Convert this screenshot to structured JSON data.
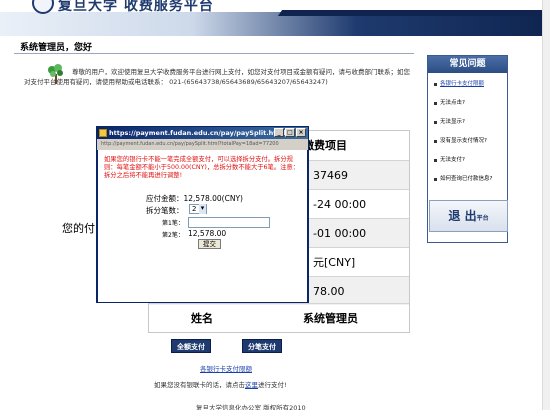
{
  "header": {
    "title": "复旦大学 收费服务平台"
  },
  "welcome": "系统管理员，您好",
  "notice": "尊敬的用户，欢迎使用复旦大学收费服务平台进行网上支付，如您对支付项目或金额有疑问，请与收费部门联系；如您对支付平台使用有疑问，请使用帮助或电话联系： 021-(65643738/65643689/65643207/65643247)",
  "sidebar": {
    "title": "常见问题",
    "items": [
      {
        "label": "各银行卡支付限额",
        "link": true
      },
      {
        "label": "无法点击?",
        "link": false
      },
      {
        "label": "无法显示?",
        "link": false
      },
      {
        "label": "没有显示支付情况?",
        "link": false
      },
      {
        "label": "无法支付?",
        "link": false
      },
      {
        "label": "如何查询已付款信息?",
        "link": false
      }
    ],
    "logout": "退 出",
    "logout_sub": "平台"
  },
  "table": {
    "rows": [
      {
        "right": "缴费项目"
      },
      {
        "right": "37469"
      },
      {
        "right": "-24 00:00"
      },
      {
        "right": "-01 00:00"
      },
      {
        "right": "元[CNY]"
      },
      {
        "right": "78.00"
      },
      {
        "left": "姓名",
        "right": "系统管理员"
      }
    ],
    "left_label": "您的付"
  },
  "buttons": {
    "full_pay": "全额支付",
    "split_pay": "分笔支付"
  },
  "bank_limit_link": "各银行卡支付限额",
  "footer_hint": {
    "prefix": "如果您没有银联卡的话，请点击",
    "link": "这里",
    "suffix": "进行支付!"
  },
  "footer_copy": "复旦大学信息化办公室 版权所有2010",
  "popup": {
    "title": "https://payment.fudan.edu.cn/pay/paySplit.html?c...",
    "address": "http://payment.fudan.edu.cn/pay/paySplit.html?totalPay=18ad=77200",
    "warning": "如果您的银行卡不能一笔完成全额支付，可以选择拆分支付。拆分规则：每笔金额不能小于500.00(CNY)，总拆分数不能大于6笔。注意：拆分之后将不能再进行调整!",
    "amount_label": "应付金额：",
    "amount_value": "12,578.00(CNY)",
    "count_label": "拆分笔数：",
    "count_value": "2",
    "first_label": "第1笔：",
    "second_label": "第2笔：",
    "second_value": "12,578.00",
    "submit": "提交"
  }
}
